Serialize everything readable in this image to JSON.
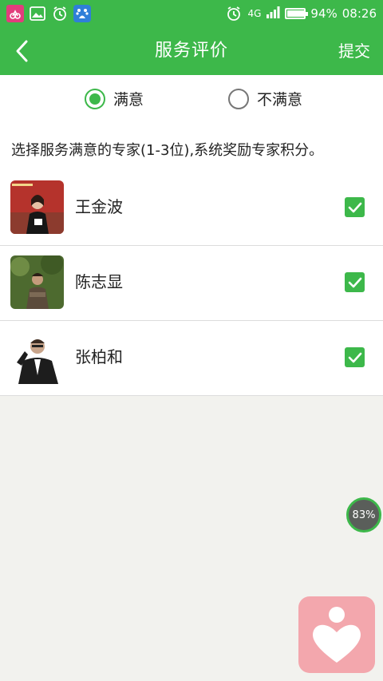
{
  "status_bar": {
    "network": "4G",
    "battery_percent": 94,
    "battery_text": "94%",
    "time": "08:26"
  },
  "app_bar": {
    "title": "服务评价",
    "submit_label": "提交",
    "back_icon": "chevron-left-icon"
  },
  "rating": {
    "options": [
      {
        "label": "满意",
        "selected": true
      },
      {
        "label": "不满意",
        "selected": false
      }
    ]
  },
  "instruction": "选择服务满意的专家(1-3位),系统奖励专家积分。",
  "experts": [
    {
      "name": "王金波",
      "checked": true
    },
    {
      "name": "陈志显",
      "checked": true
    },
    {
      "name": "张柏和",
      "checked": true
    }
  ],
  "floating": {
    "progress_text": "83%",
    "progress_value": 83
  },
  "colors": {
    "brand_green": "#3db84a",
    "float_app_pink": "#f3a7ad"
  }
}
